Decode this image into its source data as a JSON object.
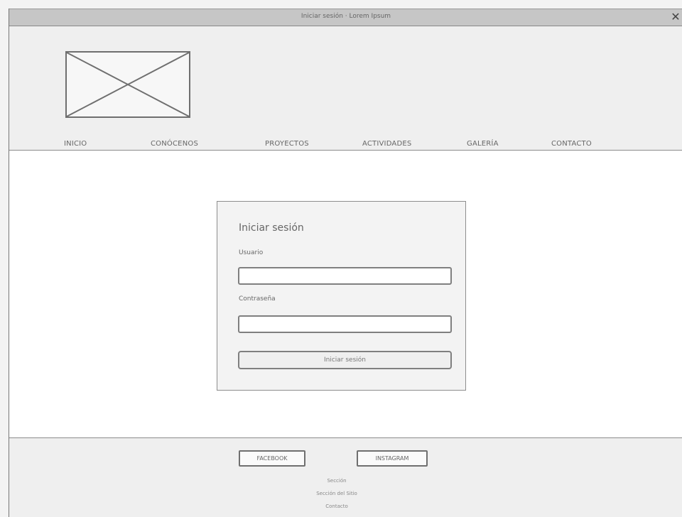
{
  "window": {
    "title": "Iniciar sesión · Lorem Ipsum"
  },
  "header": {
    "logo_icon": "image-placeholder-icon",
    "nav": [
      {
        "label": "INICIO"
      },
      {
        "label": "CONÓCENOS"
      },
      {
        "label": "PROYECTOS"
      },
      {
        "label": "ACTIVIDADES"
      },
      {
        "label": "GALERÍA"
      },
      {
        "label": "CONTACTO"
      }
    ]
  },
  "login": {
    "title": "Iniciar sesión",
    "username_label": "Usuario",
    "username_value": "",
    "password_label": "Contraseña",
    "password_value": "",
    "submit_label": "Iniciar sesión"
  },
  "footer": {
    "social": [
      {
        "label": "FACEBOOK"
      },
      {
        "label": "INSTAGRAM"
      }
    ],
    "links": [
      "Sección",
      "Sección del Sitio",
      "Contacto"
    ]
  },
  "colors": {
    "border": "#7f7f7f",
    "header_bg": "#efefef",
    "main_bg": "#ffffff",
    "panel_bg": "#f3f3f3"
  }
}
